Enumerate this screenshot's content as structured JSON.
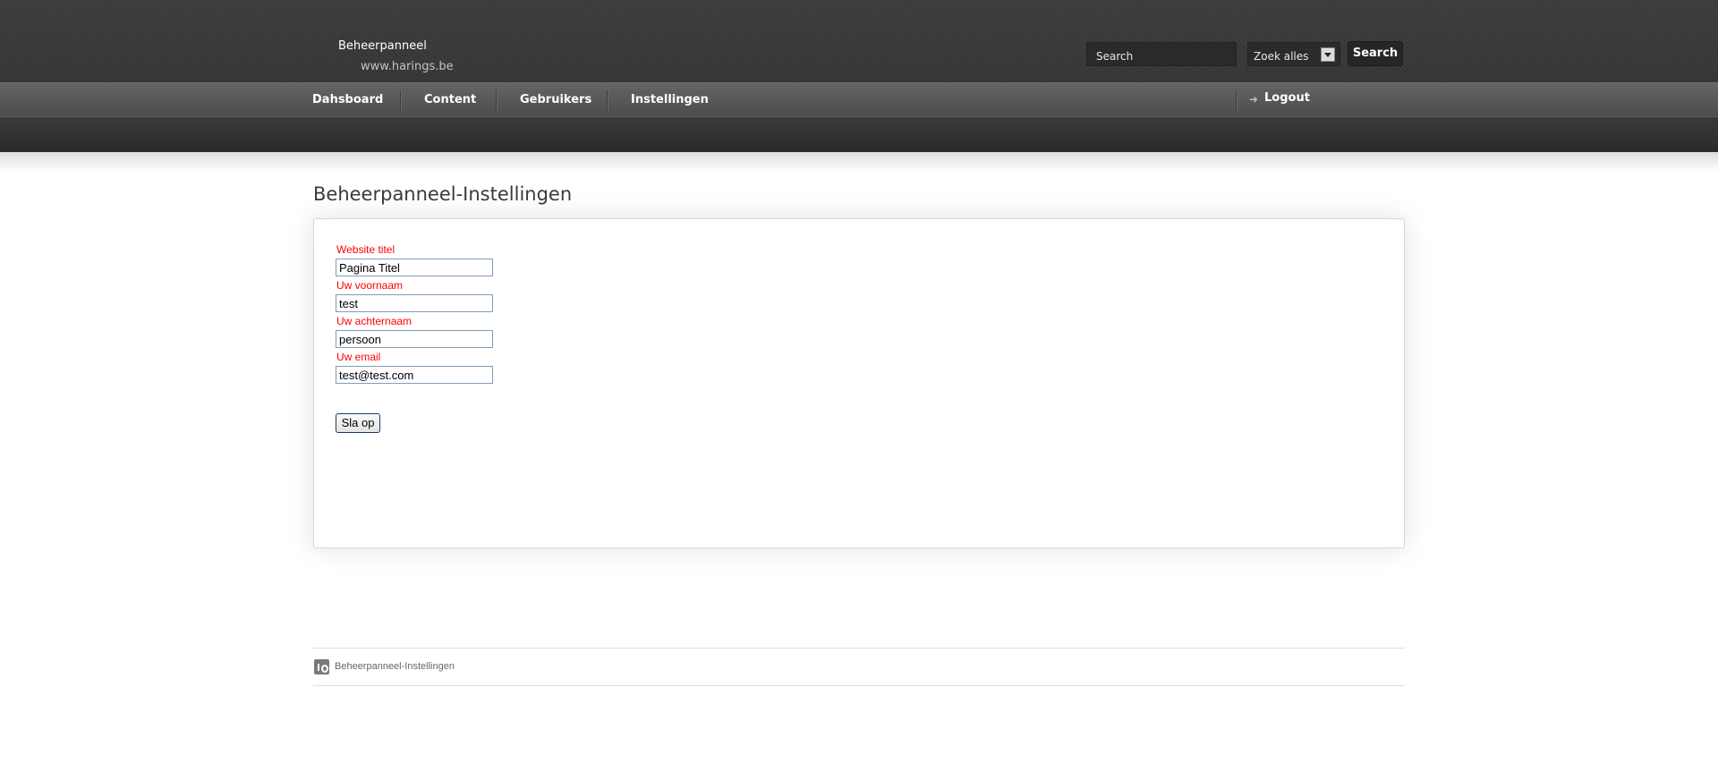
{
  "header": {
    "brand_title": "Beheerpanneel",
    "brand_url": "www.harings.be",
    "search": {
      "placeholder": "Search",
      "scope_selected": "Zoek alles",
      "button_label": "Search"
    }
  },
  "nav": {
    "items": [
      {
        "label": "Dahsboard"
      },
      {
        "label": "Content"
      },
      {
        "label": "Gebruikers"
      },
      {
        "label": "Instellingen"
      }
    ],
    "logout_label": "Logout"
  },
  "main": {
    "page_title": "Beheerpanneel-Instellingen",
    "form": {
      "fields": [
        {
          "label": "Website titel",
          "value": "Pagina Titel"
        },
        {
          "label": "Uw voornaam",
          "value": "test"
        },
        {
          "label": "Uw achternaam",
          "value": "persoon"
        },
        {
          "label": "Uw email",
          "value": "test@test.com"
        }
      ],
      "submit_label": "Sla op"
    }
  },
  "footer": {
    "breadcrumb": "Beheerpanneel-Instellingen",
    "icon": "id-icon"
  },
  "colors": {
    "field_label": "#ff0000",
    "topbar": "#3a3a3a",
    "navbar": "#5a5a5a"
  }
}
